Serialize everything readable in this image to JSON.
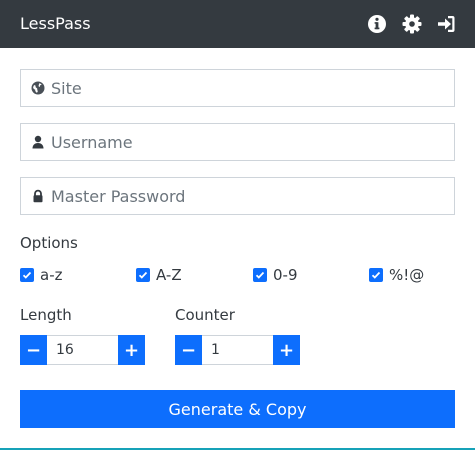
{
  "header": {
    "title": "LessPass",
    "icons": [
      "info-icon",
      "gear-icon",
      "sign-in-icon"
    ]
  },
  "form": {
    "site": {
      "placeholder": "Site",
      "value": "",
      "icon": "globe-icon"
    },
    "username": {
      "placeholder": "Username",
      "value": "",
      "icon": "user-icon"
    },
    "master_password": {
      "placeholder": "Master Password",
      "value": "",
      "icon": "lock-icon"
    }
  },
  "options": {
    "label": "Options",
    "items": [
      {
        "label": "a-z",
        "checked": true
      },
      {
        "label": "A-Z",
        "checked": true
      },
      {
        "label": "0-9",
        "checked": true
      },
      {
        "label": "%!@",
        "checked": true
      }
    ]
  },
  "length": {
    "label": "Length",
    "value": "16",
    "minus": "−",
    "plus": "+"
  },
  "counter": {
    "label": "Counter",
    "value": "1",
    "minus": "−",
    "plus": "+"
  },
  "generate_button": "Generate & Copy",
  "colors": {
    "header_bg": "#343a40",
    "accent": "#0d6efd",
    "border": "#ced4da",
    "bottom_line": "#17a2b8"
  }
}
